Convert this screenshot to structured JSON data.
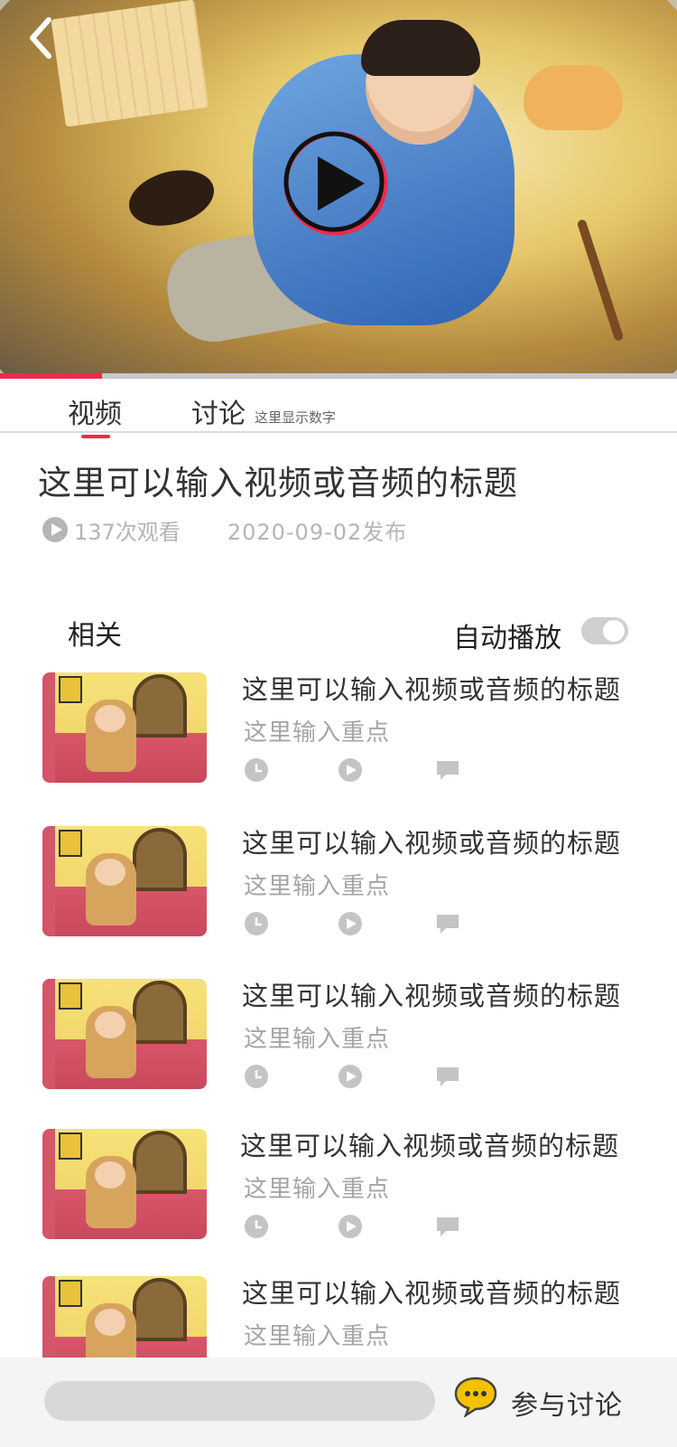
{
  "player": {
    "progress_fraction": 0.15,
    "progress_color": "#ee2a4c"
  },
  "tabs": {
    "video_label": "视频",
    "discuss_label": "讨论",
    "discuss_count_text": "这里显示数字",
    "active": "视频"
  },
  "video": {
    "title": "这里可以输入视频或音频的标题",
    "views": "137次观看",
    "published": "2020-09-02发布"
  },
  "related": {
    "label": "相关",
    "autoplay_label": "自动播放",
    "autoplay_on": false,
    "items": [
      {
        "title": "这里可以输入视频或音频的标题",
        "subtitle": "这里输入重点"
      },
      {
        "title": "这里可以输入视频或音频的标题",
        "subtitle": "这里输入重点"
      },
      {
        "title": "这里可以输入视频或音频的标题",
        "subtitle": "这里输入重点"
      },
      {
        "title": "这里可以输入视频或音频的标题",
        "subtitle": "这里输入重点"
      },
      {
        "title": "这里可以输入视频或音频的标题",
        "subtitle": "这里输入重点"
      }
    ]
  },
  "bottom_bar": {
    "comment_placeholder": "",
    "join_label": "参与讨论"
  },
  "icons": {
    "back": "chevron-left-icon",
    "play": "play-circle-icon",
    "views": "play-circle-icon",
    "duration": "clock-icon",
    "plays": "play-circle-icon",
    "comments": "speech-bubble-icon",
    "join": "chat-bubble-icon"
  },
  "colors": {
    "accent": "#ee2a4c",
    "join_icon": "#f2c200"
  }
}
